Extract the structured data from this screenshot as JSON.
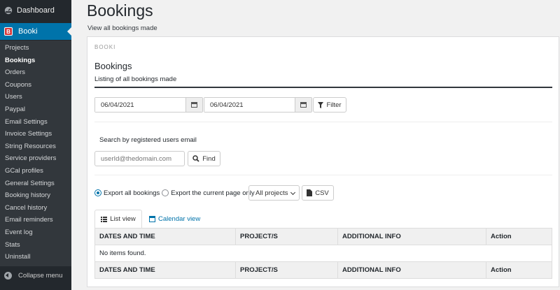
{
  "sidebar": {
    "dashboard_label": "Dashboard",
    "plugin_label": "Booki",
    "plugin_icon_letter": "B",
    "items": [
      {
        "label": "Projects"
      },
      {
        "label": "Bookings"
      },
      {
        "label": "Orders"
      },
      {
        "label": "Coupons"
      },
      {
        "label": "Users"
      },
      {
        "label": "Paypal"
      },
      {
        "label": "Email Settings"
      },
      {
        "label": "Invoice Settings"
      },
      {
        "label": "String Resources"
      },
      {
        "label": "Service providers"
      },
      {
        "label": "GCal profiles"
      },
      {
        "label": "General Settings"
      },
      {
        "label": "Booking history"
      },
      {
        "label": "Cancel history"
      },
      {
        "label": "Email reminders"
      },
      {
        "label": "Event log"
      },
      {
        "label": "Stats"
      },
      {
        "label": "Uninstall"
      }
    ],
    "active_item": "Bookings",
    "collapse_label": "Collapse menu"
  },
  "page": {
    "title": "Bookings",
    "subtitle": "View all bookings made"
  },
  "panel": {
    "label": "BOOKI",
    "heading": "Bookings",
    "description": "Listing of all bookings made"
  },
  "filter": {
    "date_from": "06/04/2021",
    "date_to": "06/04/2021",
    "filter_button": "Filter"
  },
  "search": {
    "label": "Search by registered users email",
    "placeholder": "userId@thedomain.com",
    "find_button": "Find"
  },
  "export": {
    "option_all": "Export all bookings",
    "option_page": "Export the current page only",
    "selected_option": "Export all bookings",
    "projects_select": "All projects",
    "csv_button": "CSV"
  },
  "tabs": {
    "list_view": "List view",
    "calendar_view": "Calendar view",
    "active": "List view"
  },
  "table": {
    "columns": [
      "DATES AND TIME",
      "PROJECT/S",
      "ADDITIONAL INFO",
      "Action"
    ],
    "empty_message": "No items found."
  },
  "colors": {
    "sidebar_bg": "#23282d",
    "submenu_bg": "#32373c",
    "accent": "#0073aa",
    "plugin_icon": "#d63638"
  }
}
